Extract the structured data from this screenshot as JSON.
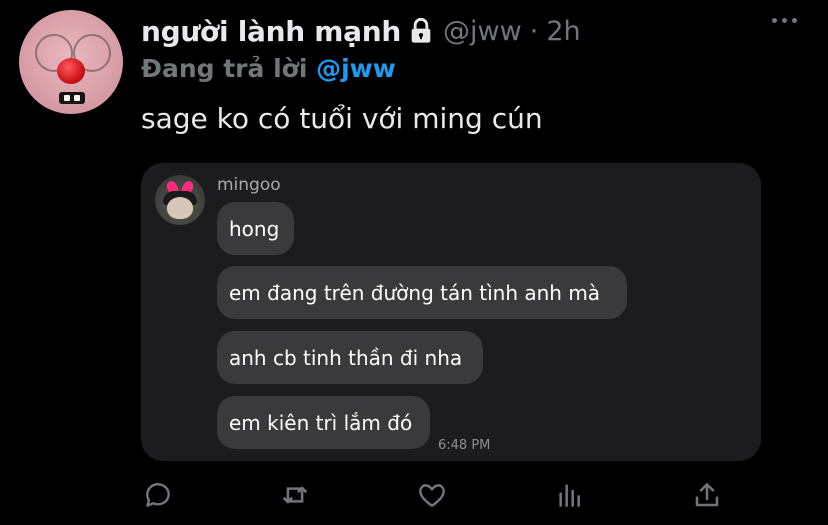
{
  "tweet": {
    "display_name": "người lành mạnh",
    "handle": "@jww",
    "separator": "·",
    "time": "2h",
    "replying_prefix": "Đang trả lời",
    "replying_to": "@jww",
    "text": "sage ko có tuổi với ming cún"
  },
  "screenshot": {
    "sender": "mingoo",
    "messages": [
      "hong",
      "em đang trên đường tán tình anh mà",
      "anh cb tinh thần đi nha",
      "em kiên trì lắm đó"
    ],
    "timestamp": "6:48 PM"
  },
  "icons": {
    "lock": "lock-icon",
    "more": "more-icon",
    "reply": "reply-icon",
    "retweet": "retweet-icon",
    "like": "like-icon",
    "views": "views-icon",
    "share": "share-icon"
  },
  "colors": {
    "background": "#000000",
    "text": "#e7e9ea",
    "secondary": "#71767b",
    "link": "#1d9bf0",
    "media_bg": "#1c1c1e",
    "bubble": "#3a3a3c"
  }
}
